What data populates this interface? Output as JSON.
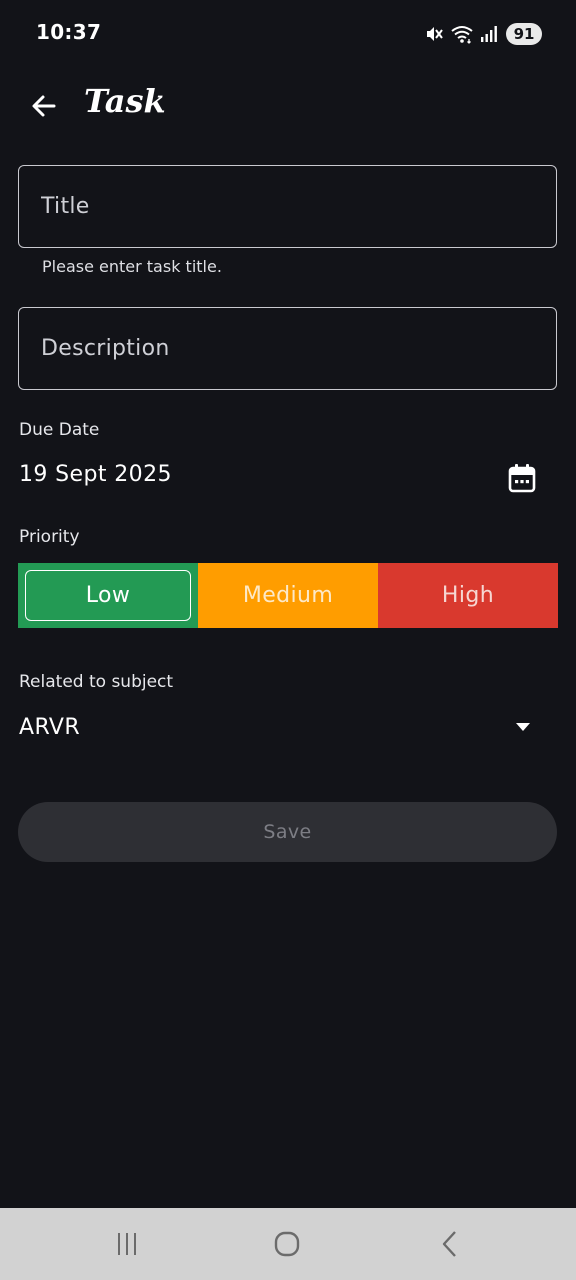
{
  "status_bar": {
    "time": "10:37",
    "battery": "91",
    "icons": [
      "mute-vibrate-icon",
      "wifi-icon",
      "signal-icon",
      "battery-icon"
    ]
  },
  "app_bar": {
    "back_icon": "arrow-left-icon",
    "title": "Task"
  },
  "form": {
    "title_field": {
      "placeholder": "Title",
      "value": "",
      "helper": "Please enter task title."
    },
    "description_field": {
      "placeholder": "Description",
      "value": ""
    },
    "due_date": {
      "label": "Due Date",
      "value": "19 Sept 2025",
      "icon": "calendar-icon"
    },
    "priority": {
      "label": "Priority",
      "selected": "Low",
      "options": [
        {
          "label": "Low",
          "color": "#239a54"
        },
        {
          "label": "Medium",
          "color": "#ff9d00"
        },
        {
          "label": "High",
          "color": "#d9392e"
        }
      ]
    },
    "subject": {
      "label": "Related to subject",
      "value": "ARVR"
    },
    "save_label": "Save"
  },
  "nav_bar": {
    "icons": [
      "recents-icon",
      "home-icon",
      "back-icon"
    ]
  },
  "colors": {
    "background": "#121318",
    "border": "#c9c9cf",
    "save_button_bg": "#2e2f34",
    "nav_bar_bg": "#d2d2d2"
  }
}
